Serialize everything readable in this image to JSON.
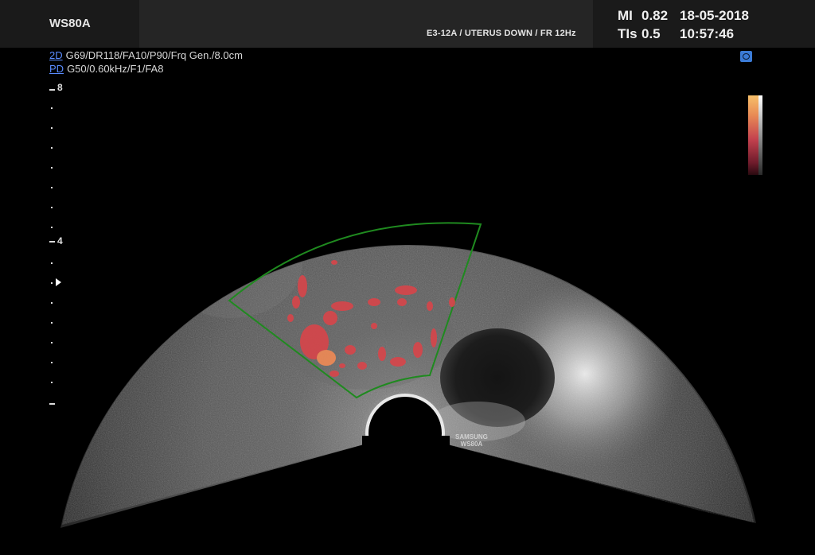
{
  "header": {
    "device": "WS80A",
    "probe_info": "E3-12A / UTERUS DOWN / FR 12Hz",
    "mi_label": "MI",
    "mi_value": "0.82",
    "tis_label": "TIs",
    "tis_value": "0.5",
    "date": "18-05-2018",
    "time": "10:57:46"
  },
  "params": {
    "mode_2d": "2D",
    "params_2d": "G69/DR118/FA10/P90/Frq Gen./8.0cm",
    "mode_pd": "PD",
    "params_pd": "G50/0.60kHz/F1/FA8"
  },
  "depth_scale": {
    "top_label": "8",
    "mid_label": "4"
  },
  "watermark": {
    "line1": "SAMSUNG",
    "line2": "WS80A"
  },
  "icons": {
    "view_badge": "eye-icon",
    "focus_marker": "focus-arrow-icon"
  },
  "colors": {
    "roi_box": "#1f8a1f",
    "mode_tag": "#5a8cff",
    "doppler": "#d8454a"
  }
}
